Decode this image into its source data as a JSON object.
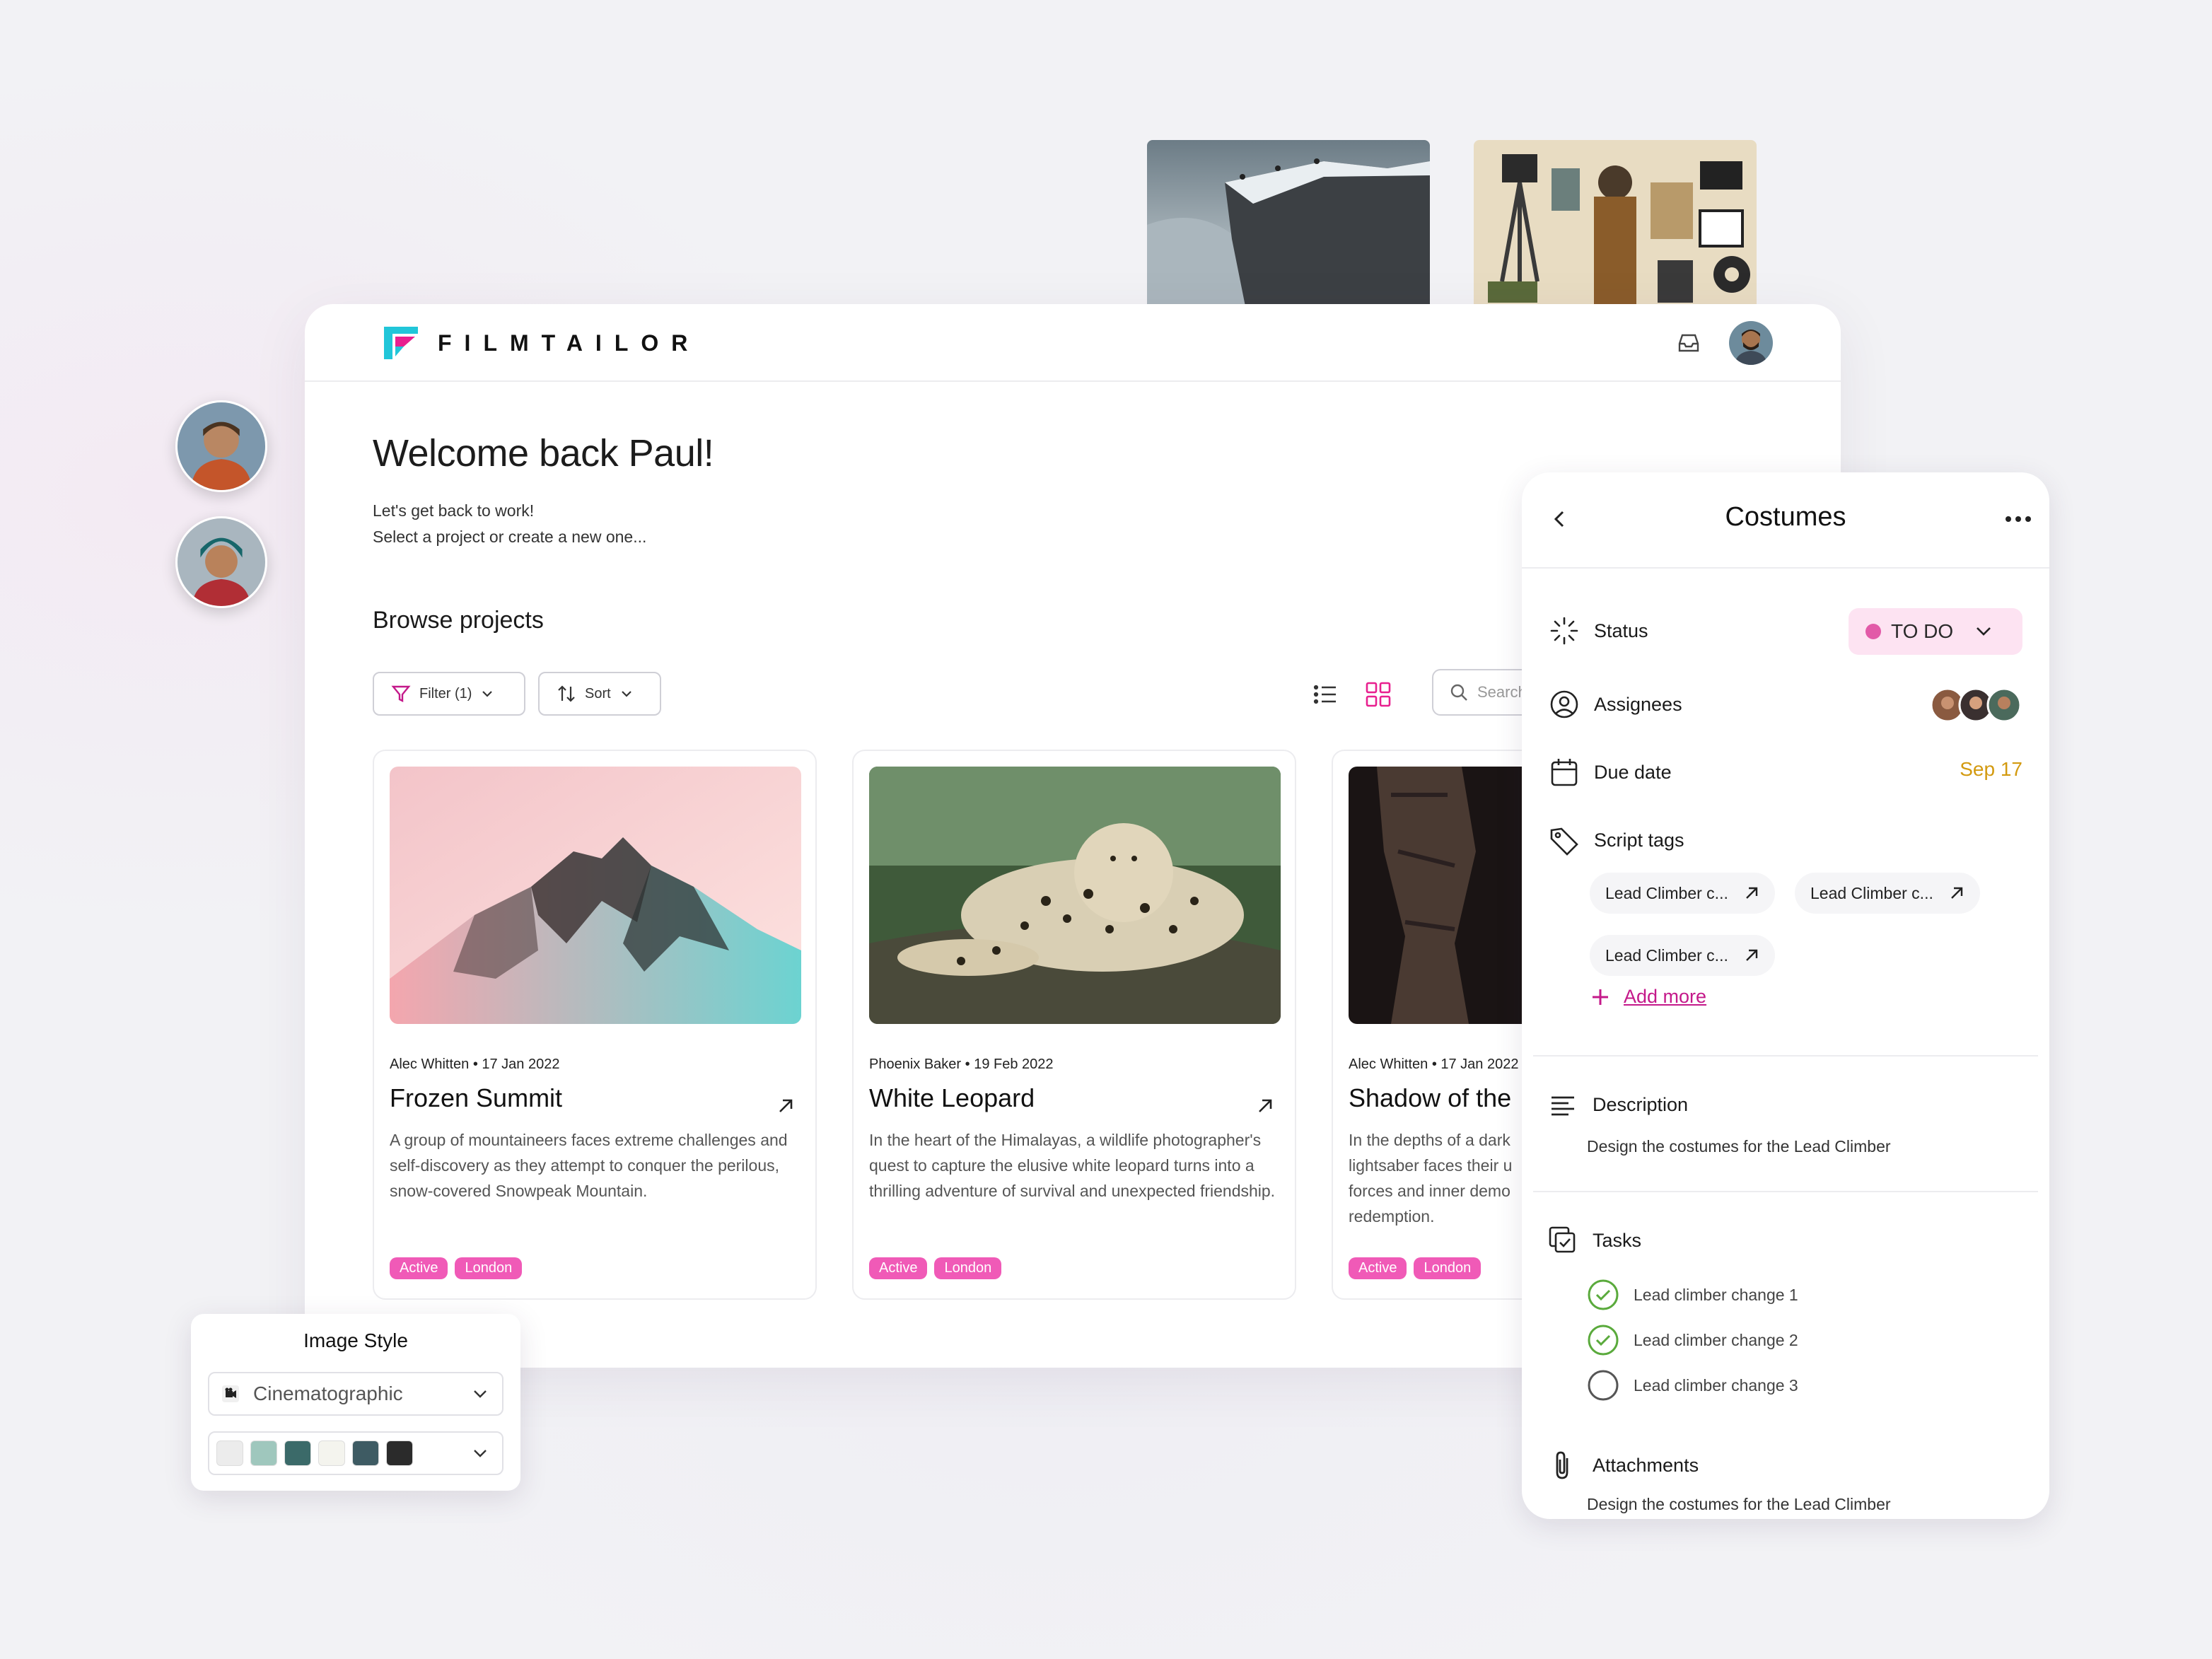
{
  "app": {
    "logo_text": "FILMTAILOR"
  },
  "main": {
    "welcome": "Welcome back Paul!",
    "subtitle_1": "Let's get back to work!",
    "subtitle_2": "Select a project or create a new one...",
    "browse_title": "Browse projects",
    "filter_label": "Filter (1)",
    "sort_label": "Sort",
    "search_placeholder": "Search"
  },
  "projects": [
    {
      "meta": "Alec Whitten • 17 Jan 2022",
      "title": "Frozen Summit",
      "description": "A group of mountaineers faces extreme challenges and self-discovery as they attempt to conquer the perilous, snow-covered Snowpeak Mountain.",
      "tags": [
        "Active",
        "London"
      ]
    },
    {
      "meta": "Phoenix Baker • 19 Feb 2022",
      "title": "White Leopard",
      "description": "In the heart of the Himalayas, a wildlife photographer's quest to capture the elusive white leopard turns into a thrilling adventure of survival and unexpected friendship.",
      "tags": [
        "Active",
        "London"
      ]
    },
    {
      "meta": "Alec Whitten • 17 Jan 2022",
      "title": "Shadow of the",
      "description": "In the depths of a dark lightsaber faces their u forces and inner demo redemption.",
      "tags": [
        "Active",
        "London"
      ]
    }
  ],
  "panel": {
    "title": "Costumes",
    "status_label": "Status",
    "status_value": "TO DO",
    "assignees_label": "Assignees",
    "due_label": "Due date",
    "due_value": "Sep 17",
    "script_tags_label": "Script tags",
    "script_tags": [
      "Lead Climber c...",
      "Lead Climber c...",
      "Lead Climber c..."
    ],
    "add_more": "Add more",
    "description_label": "Description",
    "description_text": "Design the costumes for the Lead Climber",
    "tasks_label": "Tasks",
    "tasks": [
      {
        "label": "Lead climber change 1",
        "done": true
      },
      {
        "label": "Lead climber change 2",
        "done": true
      },
      {
        "label": "Lead climber change 3",
        "done": false
      }
    ],
    "attachments_label": "Attachments",
    "attachments_text": "Design the costumes for the Lead Climber"
  },
  "image_style": {
    "title": "Image Style",
    "selected": "Cinematographic",
    "palette": [
      "#ececec",
      "#9fc7bd",
      "#3b6a69",
      "#f4f4ee",
      "#3e5b63",
      "#2b2b2b"
    ]
  },
  "colors": {
    "accent": "#f05ab7",
    "link": "#c4198a",
    "due": "#d39a10",
    "success": "#5aaa3c"
  },
  "icons": [
    "filmtailor-logo-icon",
    "inbox-icon",
    "filter-icon",
    "sort-icon",
    "chevron-down-icon",
    "list-view-icon",
    "grid-view-icon",
    "search-icon",
    "arrow-up-right-icon",
    "back-chevron-icon",
    "more-icon",
    "status-spinner-icon",
    "user-circle-icon",
    "calendar-icon",
    "tag-icon",
    "plus-icon",
    "align-left-icon",
    "tasks-icon",
    "check-circle-icon",
    "empty-circle-icon",
    "paperclip-icon",
    "camera-icon"
  ]
}
